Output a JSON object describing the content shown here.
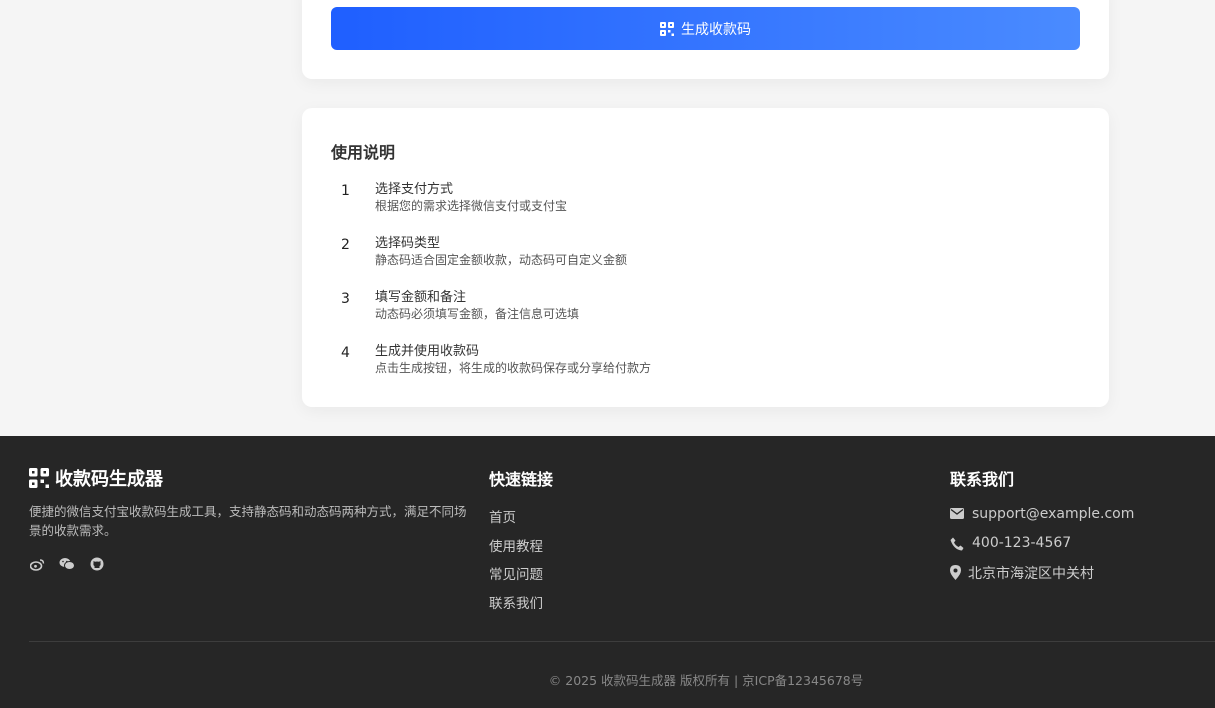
{
  "generate_button": {
    "label": "生成收款码"
  },
  "guide": {
    "title": "使用说明",
    "steps": [
      {
        "num": "1",
        "title": "选择支付方式",
        "desc": "根据您的需求选择微信支付或支付宝"
      },
      {
        "num": "2",
        "title": "选择码类型",
        "desc": "静态码适合固定金额收款，动态码可自定义金额"
      },
      {
        "num": "3",
        "title": "填写金额和备注",
        "desc": "动态码必须填写金额，备注信息可选填"
      },
      {
        "num": "4",
        "title": "生成并使用收款码",
        "desc": "点击生成按钮，将生成的收款码保存或分享给付款方"
      }
    ]
  },
  "footer": {
    "brand": "收款码生成器",
    "description": "便捷的微信支付宝收款码生成工具，支持静态码和动态码两种方式，满足不同场景的收款需求。",
    "social_icons": [
      "weibo-icon",
      "wechat-icon",
      "github-icon"
    ],
    "links_title": "快速链接",
    "links": [
      "首页",
      "使用教程",
      "常见问题",
      "联系我们"
    ],
    "contact_title": "联系我们",
    "contact": {
      "email": "support@example.com",
      "phone": "400-123-4567",
      "address": "北京市海淀区中关村"
    },
    "copyright": "© 2025 收款码生成器 版权所有 | 京ICP备12345678号"
  },
  "colors": {
    "accent": "#1f5fff",
    "footer_bg": "#262626",
    "page_bg": "#f5f5f5"
  }
}
